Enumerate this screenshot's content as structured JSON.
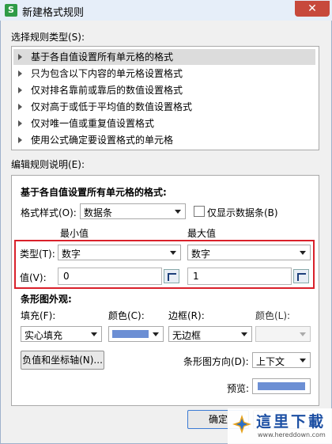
{
  "window": {
    "title": "新建格式规则",
    "app_icon_glyph": "S",
    "close_glyph": "✕"
  },
  "rule_type": {
    "label": "选择规则类型(S):",
    "items": [
      "基于各自值设置所有单元格的格式",
      "只为包含以下内容的单元格设置格式",
      "仅对排名靠前或靠后的数值设置格式",
      "仅对高于或低于平均值的数值设置格式",
      "仅对唯一值或重复值设置格式",
      "使用公式确定要设置格式的单元格"
    ]
  },
  "edit": {
    "label": "编辑规则说明(E):",
    "heading": "基于各自值设置所有单元格的格式:",
    "format_style_label": "格式样式(O):",
    "format_style_value": "数据条",
    "show_bar_only_label": "仅显示数据条(B)",
    "min_header": "最小值",
    "max_header": "最大值",
    "type_label": "类型(T):",
    "min_type": "数字",
    "max_type": "数字",
    "value_label": "值(V):",
    "min_value": "0",
    "max_value": "1",
    "bar_appearance_label": "条形图外观:",
    "fill_label": "填充(F):",
    "fill_value": "实心填充",
    "color_label": "颜色(C):",
    "border_label": "边框(R):",
    "border_value": "无边框",
    "border_color_label": "颜色(L):",
    "axis_button": "负值和坐标轴(N)...",
    "direction_label": "条形图方向(D):",
    "direction_value": "上下文",
    "preview_label": "预览:",
    "bar_color": "#6c8fd4"
  },
  "buttons": {
    "ok": "确定"
  },
  "watermark": {
    "text": "這里下載",
    "url": "www.hereddown.com"
  }
}
